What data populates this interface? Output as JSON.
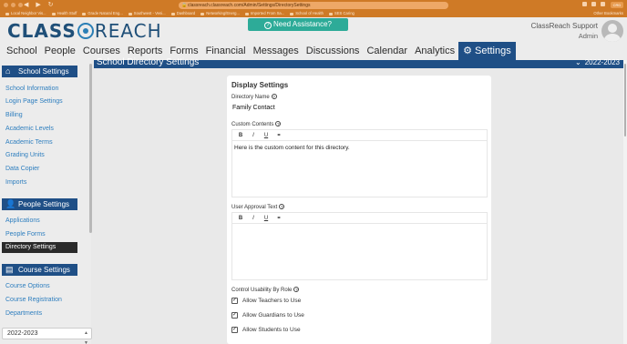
{
  "browser": {
    "url": "classreach.classreach.com/Admin/Settings/DirectorySettings",
    "extension_badge": "CRD",
    "bookmarks": [
      "Local Neighbor Vis...",
      "Health Stuff",
      "Grade Natural Eng...",
      "Southwest - Veni...",
      "Dashboard",
      "Networking/Energ...",
      "Imported From Sa...",
      "School of Health",
      "SES Caring"
    ],
    "other_bookmarks": "Other Bookmarks"
  },
  "header": {
    "logo_text_a": "CLASS",
    "logo_text_b": "REACH",
    "help_label": "Need Assistance?",
    "user_name": "ClassReach Support",
    "user_role": "Admin"
  },
  "nav": {
    "items": [
      "School",
      "People",
      "Courses",
      "Reports",
      "Forms",
      "Financial",
      "Messages",
      "Discussions",
      "Calendar",
      "Analytics",
      "Settings"
    ],
    "active": "Settings"
  },
  "sidebar": {
    "school_settings": {
      "title": "School Settings",
      "links": [
        "School Information",
        "Login Page Settings",
        "Billing",
        "Academic Levels",
        "Academic Terms",
        "Grading Units",
        "Data Copier",
        "Imports"
      ]
    },
    "people_settings": {
      "title": "People Settings",
      "links": [
        "Applications",
        "People Forms",
        "Directory Settings"
      ],
      "active": "Directory Settings"
    },
    "course_settings": {
      "title": "Course Settings",
      "links": [
        "Course Options",
        "Course Registration",
        "Departments"
      ]
    },
    "year_select": "2022-2023"
  },
  "content": {
    "title": "School Directory Settings",
    "year": "2022-2023"
  },
  "panel": {
    "title": "Display Settings",
    "directory_name_label": "Directory Name",
    "directory_name_value": "Family Contact",
    "custom_contents_label": "Custom Contents",
    "custom_contents_value": "Here is the custom content for this directory.",
    "user_approval_label": "User Approval Text",
    "user_approval_value": "",
    "toolbar": [
      "B",
      "I",
      "U",
      "🔗"
    ],
    "control_label": "Control Usability By Role",
    "checkboxes": [
      {
        "label": "Allow Teachers to Use",
        "checked": true
      },
      {
        "label": "Allow Guardians to Use",
        "checked": true
      },
      {
        "label": "Allow Students to Use",
        "checked": true
      }
    ]
  },
  "colors": {
    "brand_navy": "#1f4f86",
    "chrome_orange": "#cf7a26",
    "help_teal": "#2dab98",
    "link_blue": "#2f7fbf"
  }
}
